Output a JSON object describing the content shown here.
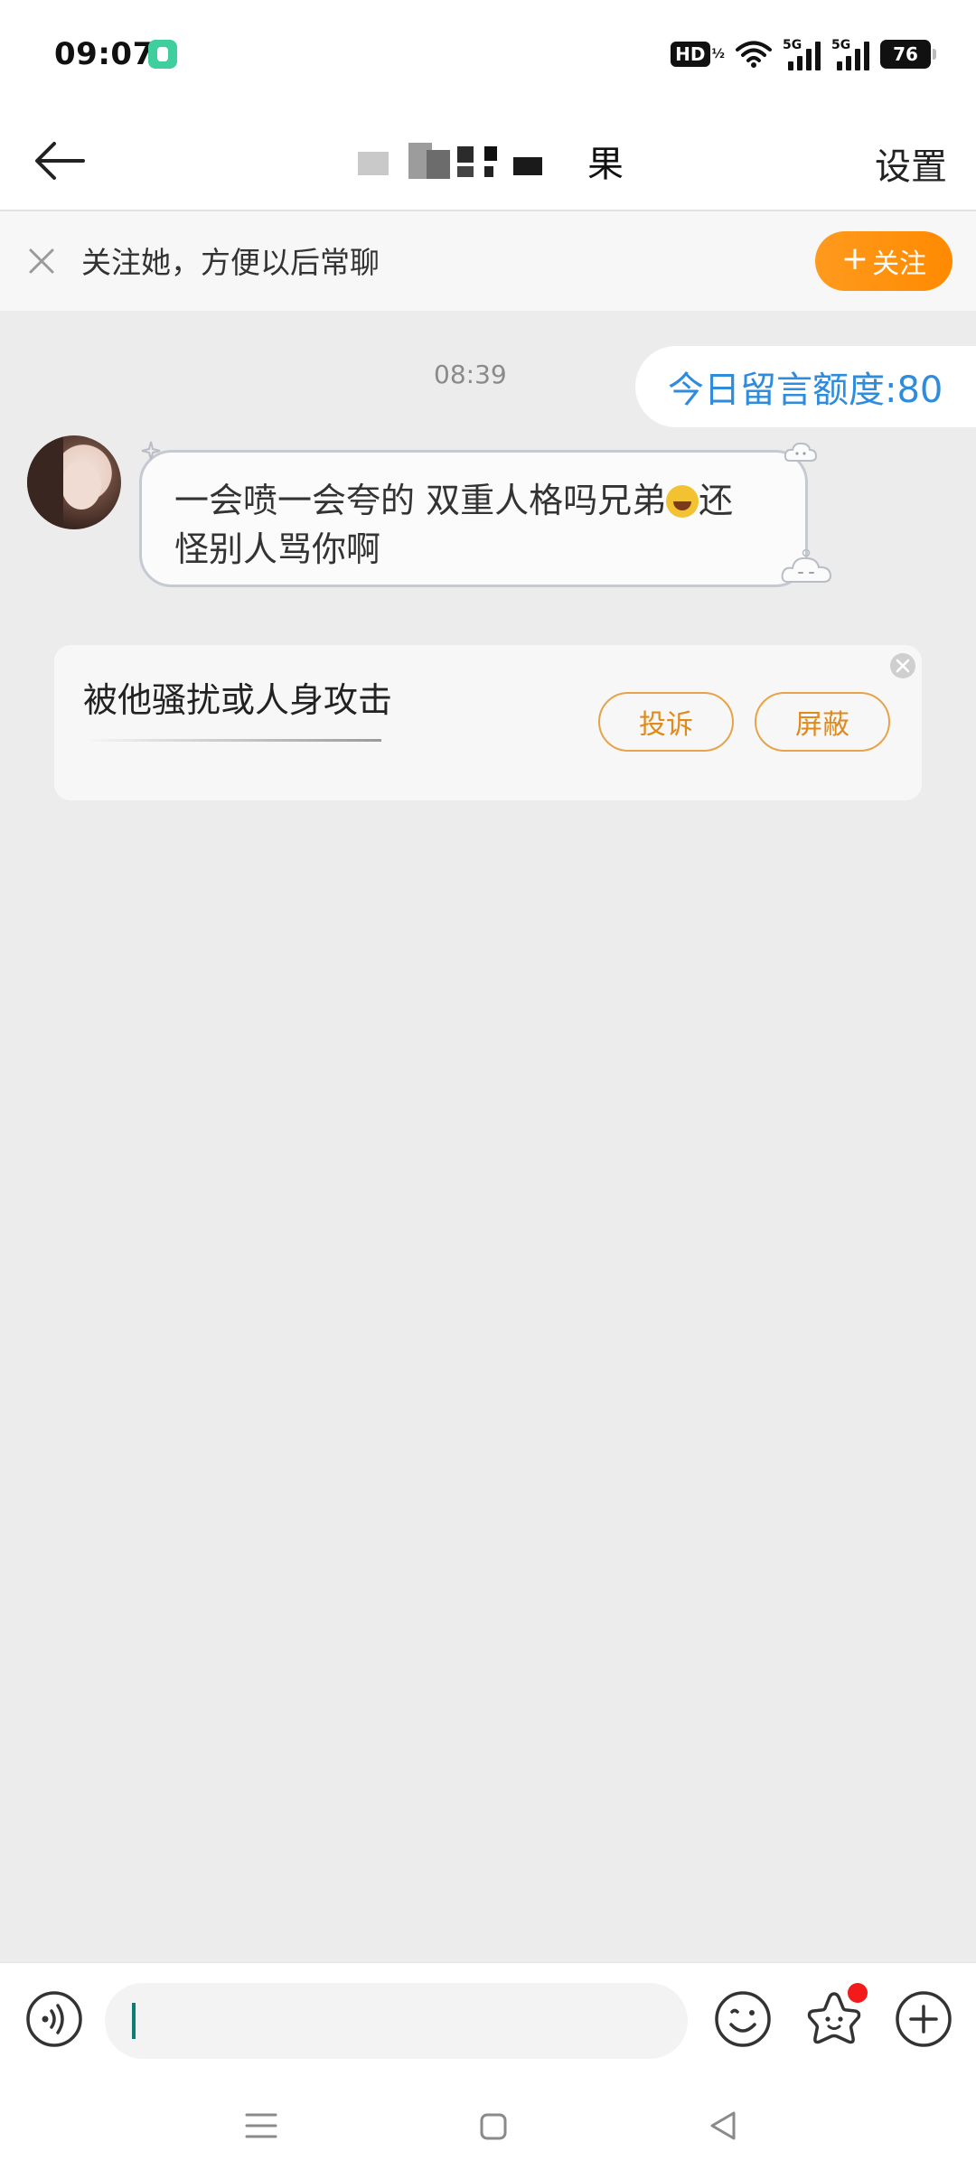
{
  "status_bar": {
    "time": "09:07",
    "hd_label": "HD",
    "hd_sub": "1\n2",
    "network_1": "5G",
    "network_2": "5G",
    "battery": "76"
  },
  "header": {
    "title_visible": "果",
    "settings_label": "设置"
  },
  "follow_banner": {
    "text": "关注她，方便以后常聊",
    "button_label": "关注"
  },
  "chat": {
    "timestamp": "08:39",
    "quota_label": "今日留言额度:80",
    "message_line1": "一会喷一会夸的 双重人格吗兄弟",
    "message_line1_end": "还",
    "message_line2": "怪别人骂你啊"
  },
  "report_card": {
    "title": "被他骚扰或人身攻击",
    "complain_label": "投诉",
    "block_label": "屏蔽"
  },
  "input_bar": {
    "placeholder": ""
  },
  "colors": {
    "accent_orange": "#ff8a00",
    "quota_blue": "#2f8bdc",
    "cursor_teal": "#0d7c74",
    "notification_red": "#f21a1a"
  },
  "icons": {
    "back": "arrow-left-icon",
    "close": "close-icon",
    "voice": "voice-icon",
    "emoji": "smiley-icon",
    "sticker": "star-sticker-icon",
    "plus": "plus-circle-icon",
    "nav_menu": "menu-icon",
    "nav_home": "home-square-icon",
    "nav_back": "back-triangle-icon"
  }
}
